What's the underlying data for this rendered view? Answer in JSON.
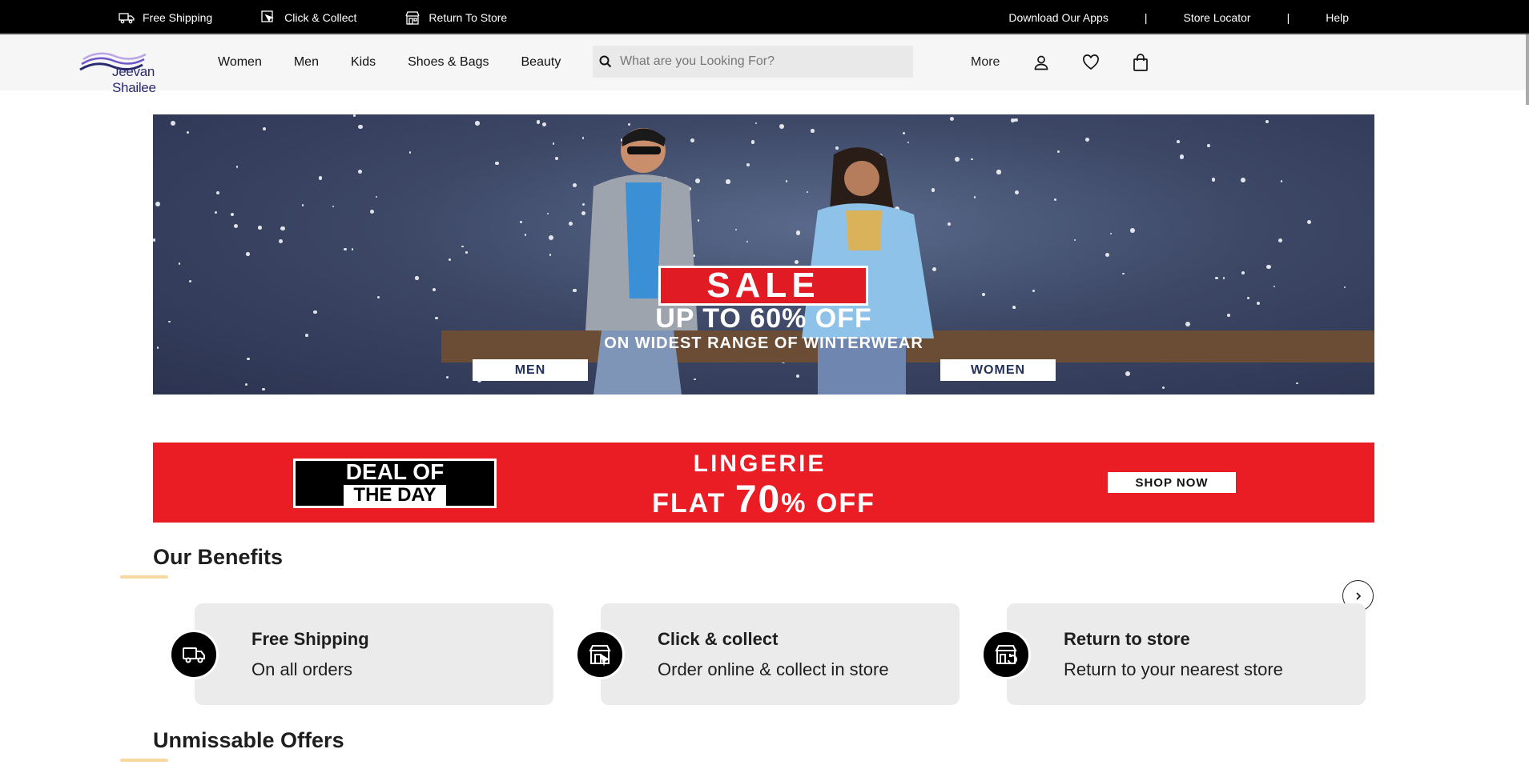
{
  "topbar": {
    "utilities": [
      {
        "label": "Free Shipping",
        "icon": "truck-icon"
      },
      {
        "label": "Click & Collect",
        "icon": "click-collect-icon"
      },
      {
        "label": "Return To Store",
        "icon": "store-icon"
      }
    ],
    "links": [
      "Download Our Apps",
      "Store Locator",
      "Help"
    ],
    "separator": "|"
  },
  "header": {
    "logo_text": "Jeevan Shailee",
    "nav": [
      "Women",
      "Men",
      "Kids",
      "Shoes & Bags",
      "Beauty"
    ],
    "search_placeholder": "What are you Looking For?",
    "more_label": "More",
    "icons": [
      "user-icon",
      "heart-icon",
      "bag-icon"
    ]
  },
  "hero": {
    "sale_label": "SALE",
    "line1": "UP TO 60% OFF",
    "line2": "ON WIDEST RANGE OF WINTERWEAR",
    "buttons": [
      "MEN",
      "WOMEN"
    ]
  },
  "deal": {
    "badge_line1": "DEAL OF",
    "badge_line2": "THE DAY",
    "category": "LINGERIE",
    "offer_prefix": "FLAT",
    "offer_number": "70",
    "offer_suffix": "% OFF",
    "cta": "SHOP NOW"
  },
  "benefits": {
    "title": "Our Benefits",
    "cards": [
      {
        "title": "Free Shipping",
        "subtitle": "On all orders",
        "icon": "truck-icon"
      },
      {
        "title": "Click & collect",
        "subtitle": "Order online & collect in store",
        "icon": "click-collect-icon"
      },
      {
        "title": "Return to store",
        "subtitle": "Return to your nearest store",
        "icon": "return-store-icon"
      }
    ],
    "next_icon": "chevron-right-icon"
  },
  "offers": {
    "title": "Unmissable Offers"
  },
  "colors": {
    "topbar_bg": "#000000",
    "header_bg": "#f6f6f6",
    "sale_red": "#e01b24",
    "deal_red": "#ea1c24",
    "accent_underline": "#f7d8a0",
    "card_bg": "#ebebeb"
  }
}
